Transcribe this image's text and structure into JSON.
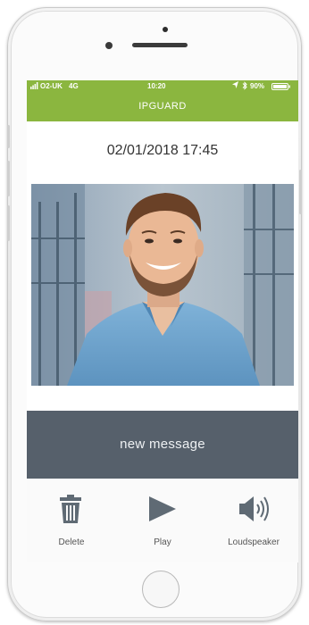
{
  "status_bar": {
    "carrier": "O2-UK",
    "network": "4G",
    "time": "10:20",
    "battery": "90%"
  },
  "app_title": "IPGUARD",
  "timestamp": "02/01/2018 17:45",
  "message_banner": "new message",
  "actions": [
    {
      "label": "Delete",
      "icon": "trash-icon"
    },
    {
      "label": "Play",
      "icon": "play-icon"
    },
    {
      "label": "Loudspeaker",
      "icon": "speaker-icon"
    }
  ],
  "colors": {
    "accent_green": "#8bb63f",
    "message_bar": "#56606b",
    "icon_gray": "#5f6a74"
  }
}
